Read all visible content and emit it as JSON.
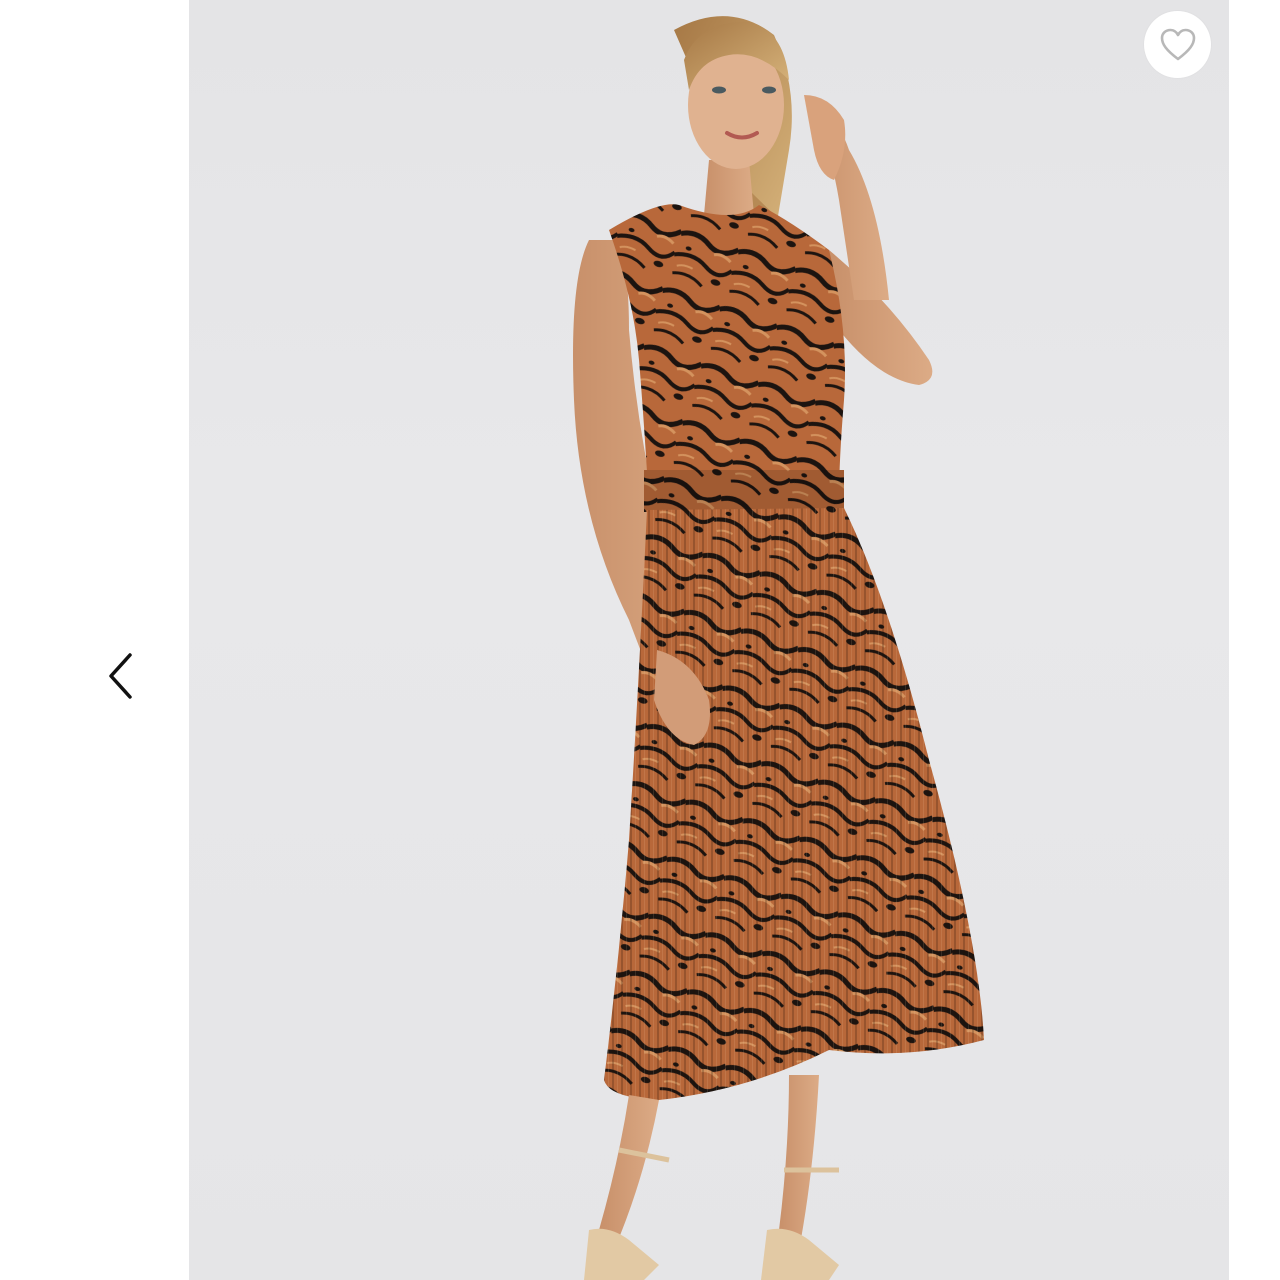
{
  "gallery": {
    "prev_icon": "chevron-left-icon",
    "like_icon": "heart-outline-icon",
    "image_subject": "woman-in-animal-print-pleated-dress",
    "colors": {
      "page_background": "#ffffff",
      "photo_background": "#e6e6e8",
      "dress_base": "#b8683a",
      "dress_stripe": "#1c1410",
      "icon_grey": "#b8b8b8",
      "chevron": "#111111"
    }
  }
}
